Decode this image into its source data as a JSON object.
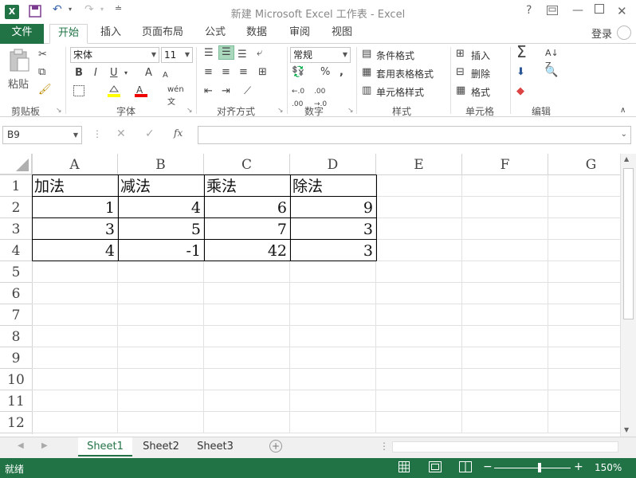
{
  "app": {
    "title": "新建 Microsoft Excel 工作表 - Excel",
    "logo": "X",
    "login": "登录"
  },
  "tabs": [
    "文件",
    "开始",
    "插入",
    "页面布局",
    "公式",
    "数据",
    "审阅",
    "视图"
  ],
  "ribbon": {
    "clipboard": {
      "paste": "粘贴",
      "label": "剪贴板"
    },
    "font": {
      "name": "宋体",
      "size": "11",
      "bold": "B",
      "italic": "I",
      "underline": "U",
      "grow": "A",
      "shrink": "A",
      "label": "字体"
    },
    "alignment": {
      "label": "对齐方式"
    },
    "number": {
      "format": "常规",
      "percent": "%",
      "comma": ",",
      "label": "数字"
    },
    "styles": {
      "conditional": "条件格式",
      "table": "套用表格格式",
      "cell": "单元格样式",
      "label": "样式"
    },
    "cells": {
      "insert": "插入",
      "delete": "删除",
      "format": "格式",
      "label": "单元格"
    },
    "editing": {
      "sum": "Σ",
      "label": "编辑"
    }
  },
  "formula_bar": {
    "name_box": "B9",
    "fx": "fx",
    "value": ""
  },
  "columns": [
    "A",
    "B",
    "C",
    "D",
    "E",
    "F",
    "G"
  ],
  "rows": [
    "1",
    "2",
    "3",
    "4",
    "5",
    "6",
    "7",
    "8",
    "9",
    "10",
    "11",
    "12"
  ],
  "cells": [
    [
      "加法",
      "减法",
      "乘法",
      "除法"
    ],
    [
      "1",
      "4",
      "6",
      "9"
    ],
    [
      "3",
      "5",
      "7",
      "3"
    ],
    [
      "4",
      "-1",
      "42",
      "3"
    ]
  ],
  "sheets": [
    "Sheet1",
    "Sheet2",
    "Sheet3"
  ],
  "status": {
    "ready": "就绪",
    "zoom": "150%"
  },
  "colors": {
    "accent": "#217346"
  }
}
